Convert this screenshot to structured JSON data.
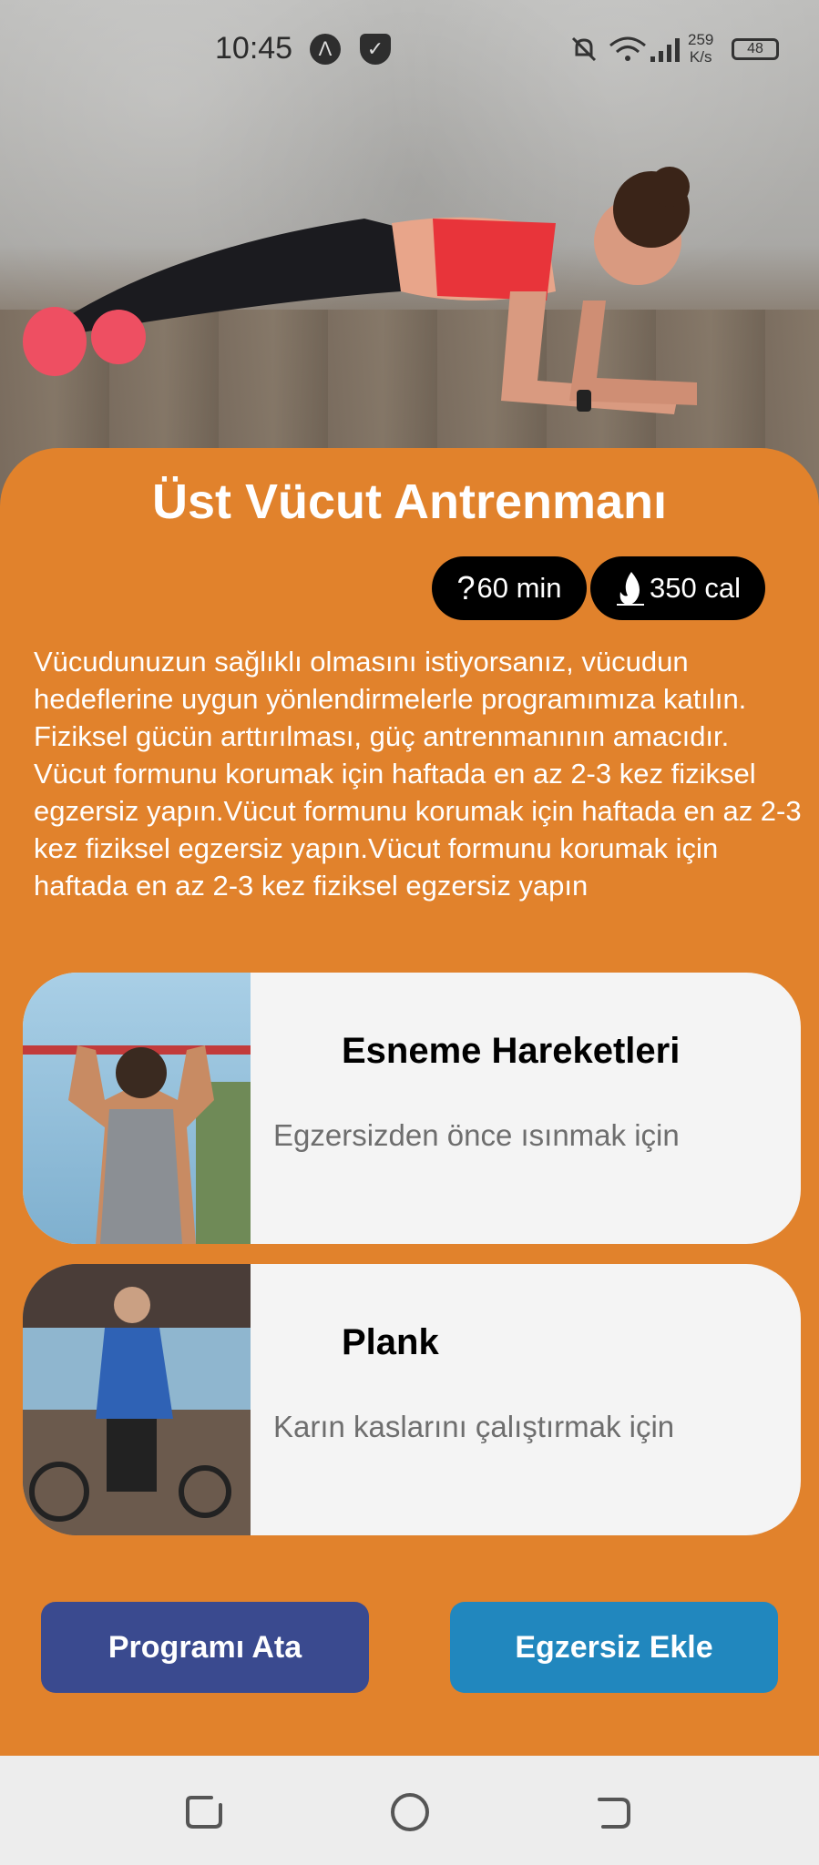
{
  "status_bar": {
    "time": "10:45",
    "net_speed_value": "259",
    "net_speed_unit": "K/s",
    "battery": "48"
  },
  "program": {
    "title": "Üst Vücut Antrenmanı",
    "duration": "60 min",
    "duration_icon": "?",
    "calories": "350 cal",
    "description": "Vücudunuzun sağlıklı olmasını istiyorsanız, vücudun hedeflerine uygun yönlendirmelerle programımıza katılın. Fiziksel gücün arttırılması, güç antrenmanının amacıdır. Vücut formunu korumak için haftada en az 2-3 kez fiziksel egzersiz yapın.Vücut formunu korumak için haftada en az 2-3 kez fiziksel egzersiz yapın.Vücut formunu korumak için haftada en az 2-3 kez fiziksel egzersiz yapın"
  },
  "exercises": [
    {
      "name": "Esneme Hareketleri",
      "subtitle": "Egzersizden önce ısınmak için"
    },
    {
      "name": "Plank",
      "subtitle": "Karın kaslarını çalıştırmak için"
    }
  ],
  "actions": {
    "assign_label": "Programı Ata",
    "add_label": "Egzersiz Ekle"
  },
  "colors": {
    "card_orange": "#e1822c",
    "assign_button": "#3a4a8f",
    "add_button": "#2187be"
  }
}
